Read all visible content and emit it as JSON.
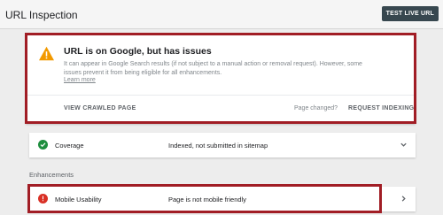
{
  "header": {
    "title": "URL Inspection",
    "test_button_label": "TEST LIVE URL"
  },
  "issue_card": {
    "title": "URL is on Google, but has issues",
    "description": "It can appear in Google Search results (if not subject to a manual action or removal request). However, some issues prevent it from being eligible for all enhancements.",
    "learn_more": "Learn more",
    "view_crawled_label": "VIEW CRAWLED PAGE",
    "page_changed_label": "Page changed?",
    "request_indexing_label": "REQUEST INDEXING",
    "icon": "warning-triangle-icon",
    "icon_color": "#f29900"
  },
  "coverage": {
    "label": "Coverage",
    "status": "Indexed, not submitted in sitemap",
    "icon": "check-circle-icon",
    "icon_color": "#1e8e3e"
  },
  "enhancements_heading": "Enhancements",
  "mobile_usability": {
    "label": "Mobile Usability",
    "status": "Page is not mobile friendly",
    "icon": "error-circle-icon",
    "icon_color": "#d93025"
  },
  "colors": {
    "highlight_border": "#a11d25",
    "test_button_bg": "#37474f"
  }
}
